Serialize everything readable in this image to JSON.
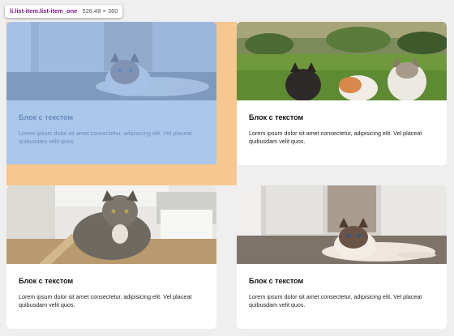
{
  "inspector": {
    "selector": "li.list-item.list-item_one",
    "dimensions": "526.48 × 360"
  },
  "cards": [
    {
      "title": "Блок с текстом",
      "text": "Lorem ipsum dolor sit amet consectetur, adipisicing elit. Vel placeat quibusdam velit quos."
    },
    {
      "title": "Блок с текстом",
      "text": "Lorem ipsum dolor sit amet consectetur, adipisicing elit. Vel placeat quibusdam velit quos."
    },
    {
      "title": "Блок с текстом",
      "text": "Lorem ipsum dolor sit amet consectetur, adipisicing elit. Vel placeat quibusdam velit quos."
    },
    {
      "title": "Блок с текстом",
      "text": "Lorem ipsum dolor sit amet consectetur, adipisicing elit. Vel placeat quibusdam velit quos."
    }
  ],
  "colors": {
    "page_background": "#efefef",
    "card_background": "#ffffff",
    "highlight_content": "#78a5e1",
    "highlight_margin": "#f6c78f",
    "selector_text": "#7a1d8a"
  }
}
